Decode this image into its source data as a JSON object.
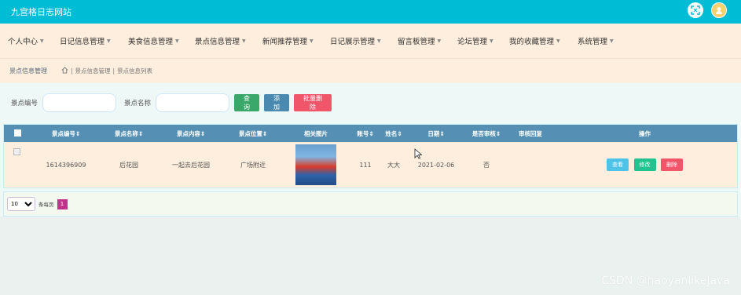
{
  "header": {
    "title": "九宫格日志网站"
  },
  "menu": [
    "个人中心",
    "日记信息管理",
    "美食信息管理",
    "景点信息管理",
    "新闻推荐管理",
    "日记展示管理",
    "留言板管理",
    "论坛管理",
    "我的收藏管理",
    "系统管理"
  ],
  "breadcrumb": {
    "section": "景点信息管理",
    "path": [
      "景点信息管理",
      "景点信息列表"
    ]
  },
  "search": {
    "code_label": "景点编号",
    "code_value": "",
    "name_label": "景点名称",
    "name_value": "",
    "search_button": "查询",
    "add_button": "添加",
    "batch_delete_button": "批量删除"
  },
  "table": {
    "columns": [
      "景点编号",
      "景点名称",
      "景点内容",
      "景点位置",
      "相关图片",
      "账号",
      "姓名",
      "日期",
      "是否审核",
      "审核回复",
      "操作"
    ],
    "rows": [
      {
        "code": "1614396909",
        "name": "后花园",
        "content": "一起去后花园",
        "location": "广场附近",
        "account": "111",
        "person": "大大",
        "date": "2021-02-06",
        "reviewed": "否",
        "reply": "",
        "actions": {
          "view": "查看",
          "edit": "修改",
          "delete": "删除"
        }
      }
    ]
  },
  "pager": {
    "page_size": "10",
    "per_page_label": "条每页",
    "current_page": "1"
  },
  "watermark": "CSDN @haoyanlikeJava",
  "colors": {
    "topbar": "#00bcd4",
    "menubar": "#fdeedd",
    "table_header": "#5590b4",
    "accent_pink": "#c0338a"
  }
}
